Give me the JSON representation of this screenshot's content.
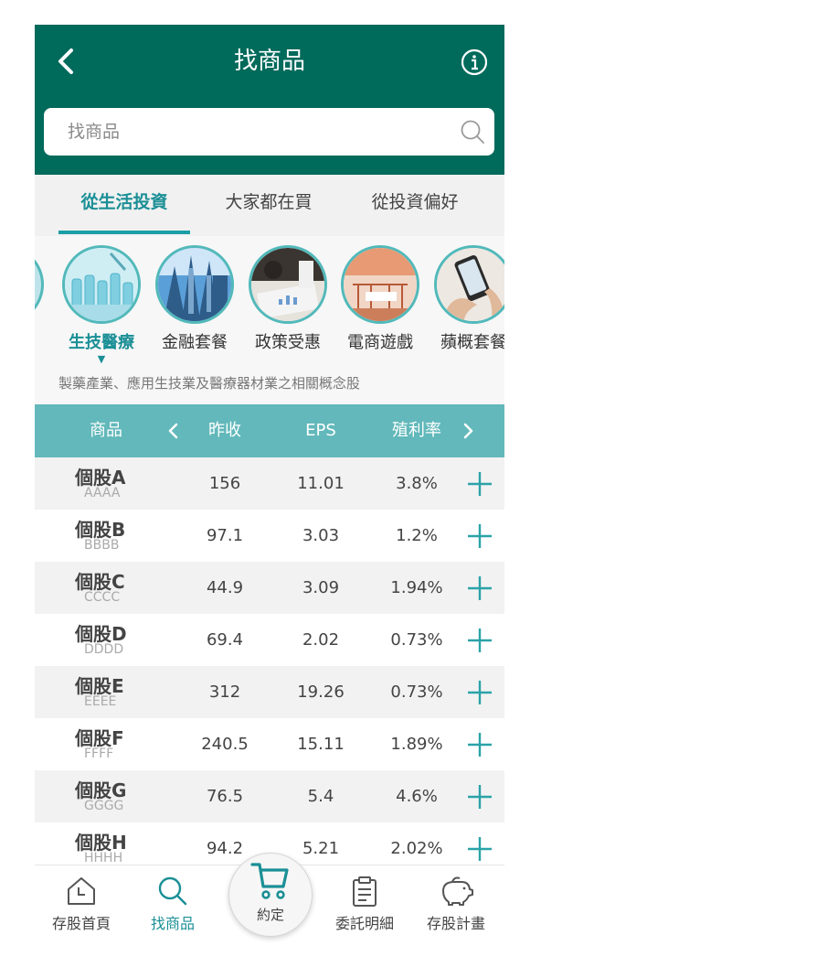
{
  "header": {
    "title": "找商品",
    "back_icon": "chevron-left-icon",
    "info_icon": "info-icon"
  },
  "search": {
    "placeholder": "找商品",
    "icon": "search-icon"
  },
  "tabs": [
    {
      "label": "從生活投資",
      "active": true
    },
    {
      "label": "大家都在買",
      "active": false
    },
    {
      "label": "從投資偏好",
      "active": false
    }
  ],
  "categories": [
    {
      "label": "生技醫療",
      "active": true
    },
    {
      "label": "金融套餐",
      "active": false
    },
    {
      "label": "政策受惠",
      "active": false
    },
    {
      "label": "電商遊戲",
      "active": false
    },
    {
      "label": "蘋概套餐",
      "active": false
    }
  ],
  "category_description": "製藥產業、應用生技業及醫療器材業之相關概念股",
  "table": {
    "headers": {
      "product": "商品",
      "close": "昨收",
      "eps": "EPS",
      "yield": "殖利率"
    },
    "rows": [
      {
        "name": "個股A",
        "code": "AAAA",
        "close": "156",
        "eps": "11.01",
        "yield": "3.8%"
      },
      {
        "name": "個股B",
        "code": "BBBB",
        "close": "97.1",
        "eps": "3.03",
        "yield": "1.2%"
      },
      {
        "name": "個股C",
        "code": "CCCC",
        "close": "44.9",
        "eps": "3.09",
        "yield": "1.94%"
      },
      {
        "name": "個股D",
        "code": "DDDD",
        "close": "69.4",
        "eps": "2.02",
        "yield": "0.73%"
      },
      {
        "name": "個股E",
        "code": "EEEE",
        "close": "312",
        "eps": "19.26",
        "yield": "0.73%"
      },
      {
        "name": "個股F",
        "code": "FFFF",
        "close": "240.5",
        "eps": "15.11",
        "yield": "1.89%"
      },
      {
        "name": "個股G",
        "code": "GGGG",
        "close": "76.5",
        "eps": "5.4",
        "yield": "4.6%"
      },
      {
        "name": "個股H",
        "code": "HHHH",
        "close": "94.2",
        "eps": "5.21",
        "yield": "2.02%"
      }
    ]
  },
  "bottom_nav": [
    {
      "label": "存股首頁",
      "icon": "home-icon",
      "active": false
    },
    {
      "label": "找商品",
      "icon": "search-icon",
      "active": true
    },
    {
      "label": "約定",
      "icon": "cart-icon",
      "active": false
    },
    {
      "label": "委託明細",
      "icon": "clipboard-icon",
      "active": false
    },
    {
      "label": "存股計畫",
      "icon": "piggy-bank-icon",
      "active": false
    }
  ],
  "colors": {
    "brand": "#006a5b",
    "accent": "#1b8f96",
    "table_header": "#62b8ba"
  }
}
